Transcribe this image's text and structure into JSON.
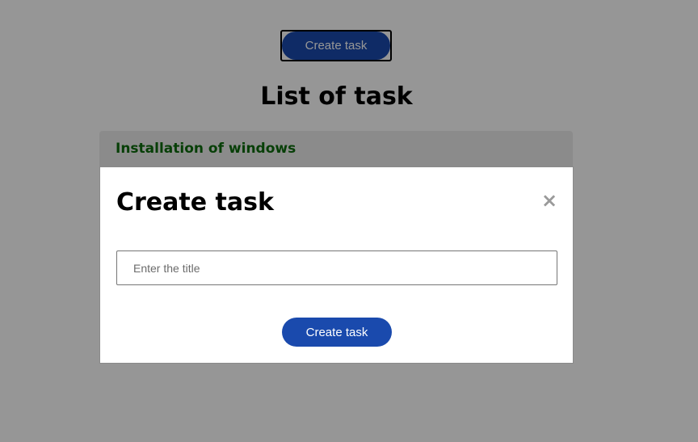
{
  "header": {
    "create_button_label": "Create task",
    "page_title": "List of task"
  },
  "tasks": [
    {
      "title": "Installation of windows"
    }
  ],
  "modal": {
    "title": "Create task",
    "close_glyph": "×",
    "title_input": {
      "placeholder": "Enter the title",
      "value": ""
    },
    "submit_label": "Create task"
  },
  "colors": {
    "primary_button": "#1a4aad",
    "task_title": "#0d6b0d",
    "overlay": "rgba(0,0,0,0.41)"
  },
  "icons": {
    "close": "close-icon"
  }
}
